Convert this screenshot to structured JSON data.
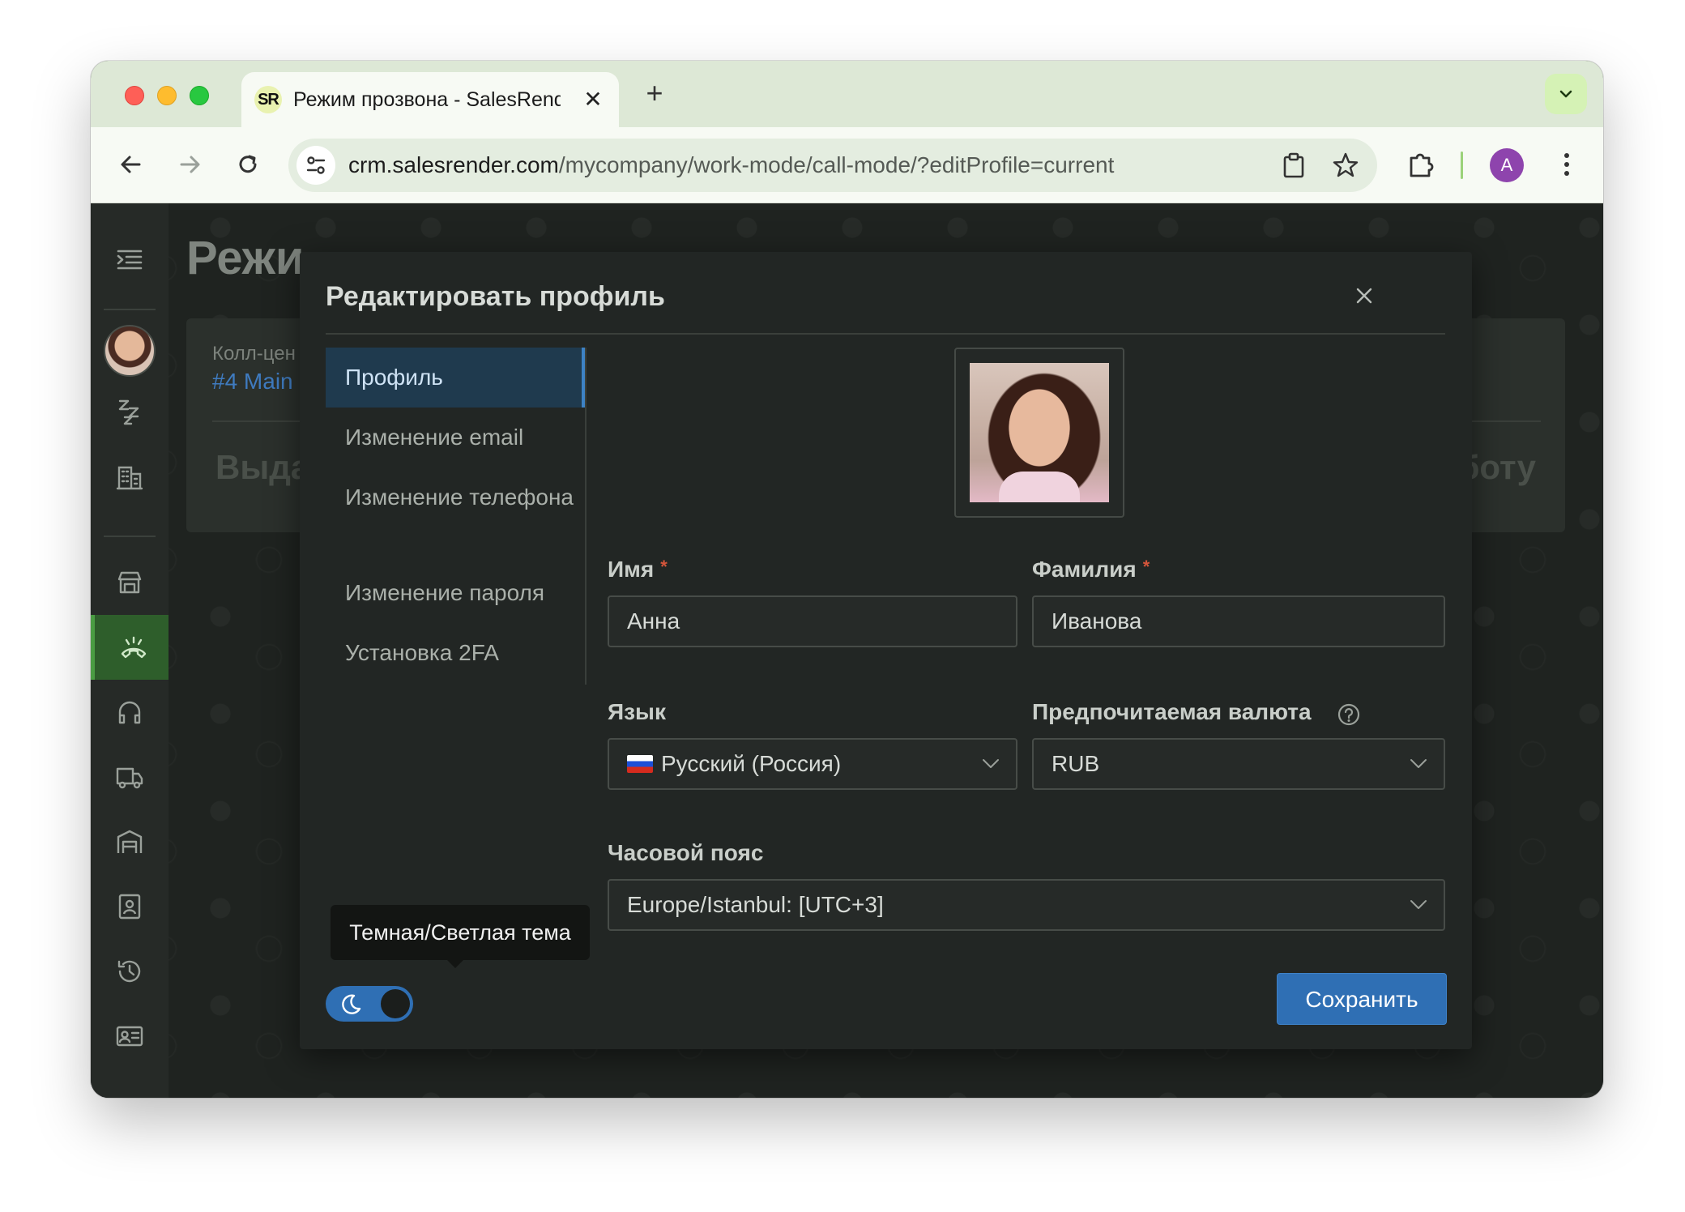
{
  "browser": {
    "tab_title": "Режим прозвона - SalesRender",
    "favicon_text": "SR",
    "tab_close_glyph": "✕",
    "new_tab_glyph": "+",
    "url_host": "crm.salesrender.com",
    "url_path": "/mycompany/work-mode/call-mode/?editProfile=current",
    "profile_initial": "A",
    "colors": {
      "tabstrip": "#dde8d6",
      "toolbar": "#f7faf4",
      "profile": "#8e44ad"
    }
  },
  "background_page": {
    "title": "Режи",
    "card_label": "Колл-цен",
    "card_link": "#4 Main",
    "card_big_left": "Выда",
    "card_big_right": "боту"
  },
  "sidebar": {
    "icons": [
      "menu-collapse-icon",
      "sleep-icon",
      "building-icon",
      "store-icon",
      "call-mode-icon",
      "headset-icon",
      "truck-icon",
      "warehouse-icon",
      "contact-card-icon",
      "history-icon",
      "id-card-icon"
    ],
    "active": "call-mode-icon",
    "active_color": "#2e5e2b"
  },
  "modal": {
    "title": "Редактировать профиль",
    "menu": [
      {
        "label": "Профиль",
        "active": true
      },
      {
        "label": "Изменение email"
      },
      {
        "label": "Изменение телефона"
      },
      {
        "label": "Изменение пароля"
      },
      {
        "label": "Установка 2FA"
      }
    ],
    "fields": {
      "first_name": {
        "label": "Имя",
        "required_mark": "*",
        "value": "Анна"
      },
      "last_name": {
        "label": "Фамилия",
        "required_mark": "*",
        "value": "Иванова"
      },
      "language": {
        "label": "Язык",
        "value": "Русский (Россия)"
      },
      "currency": {
        "label": "Предпочитаемая валюта",
        "value": "RUB"
      },
      "timezone": {
        "label": "Часовой пояс",
        "value": "Europe/Istanbul: [UTC+3]"
      }
    },
    "save_label": "Сохранить",
    "theme_tooltip": "Темная/Светлая тема",
    "accent_color": "#2f6fb4"
  }
}
